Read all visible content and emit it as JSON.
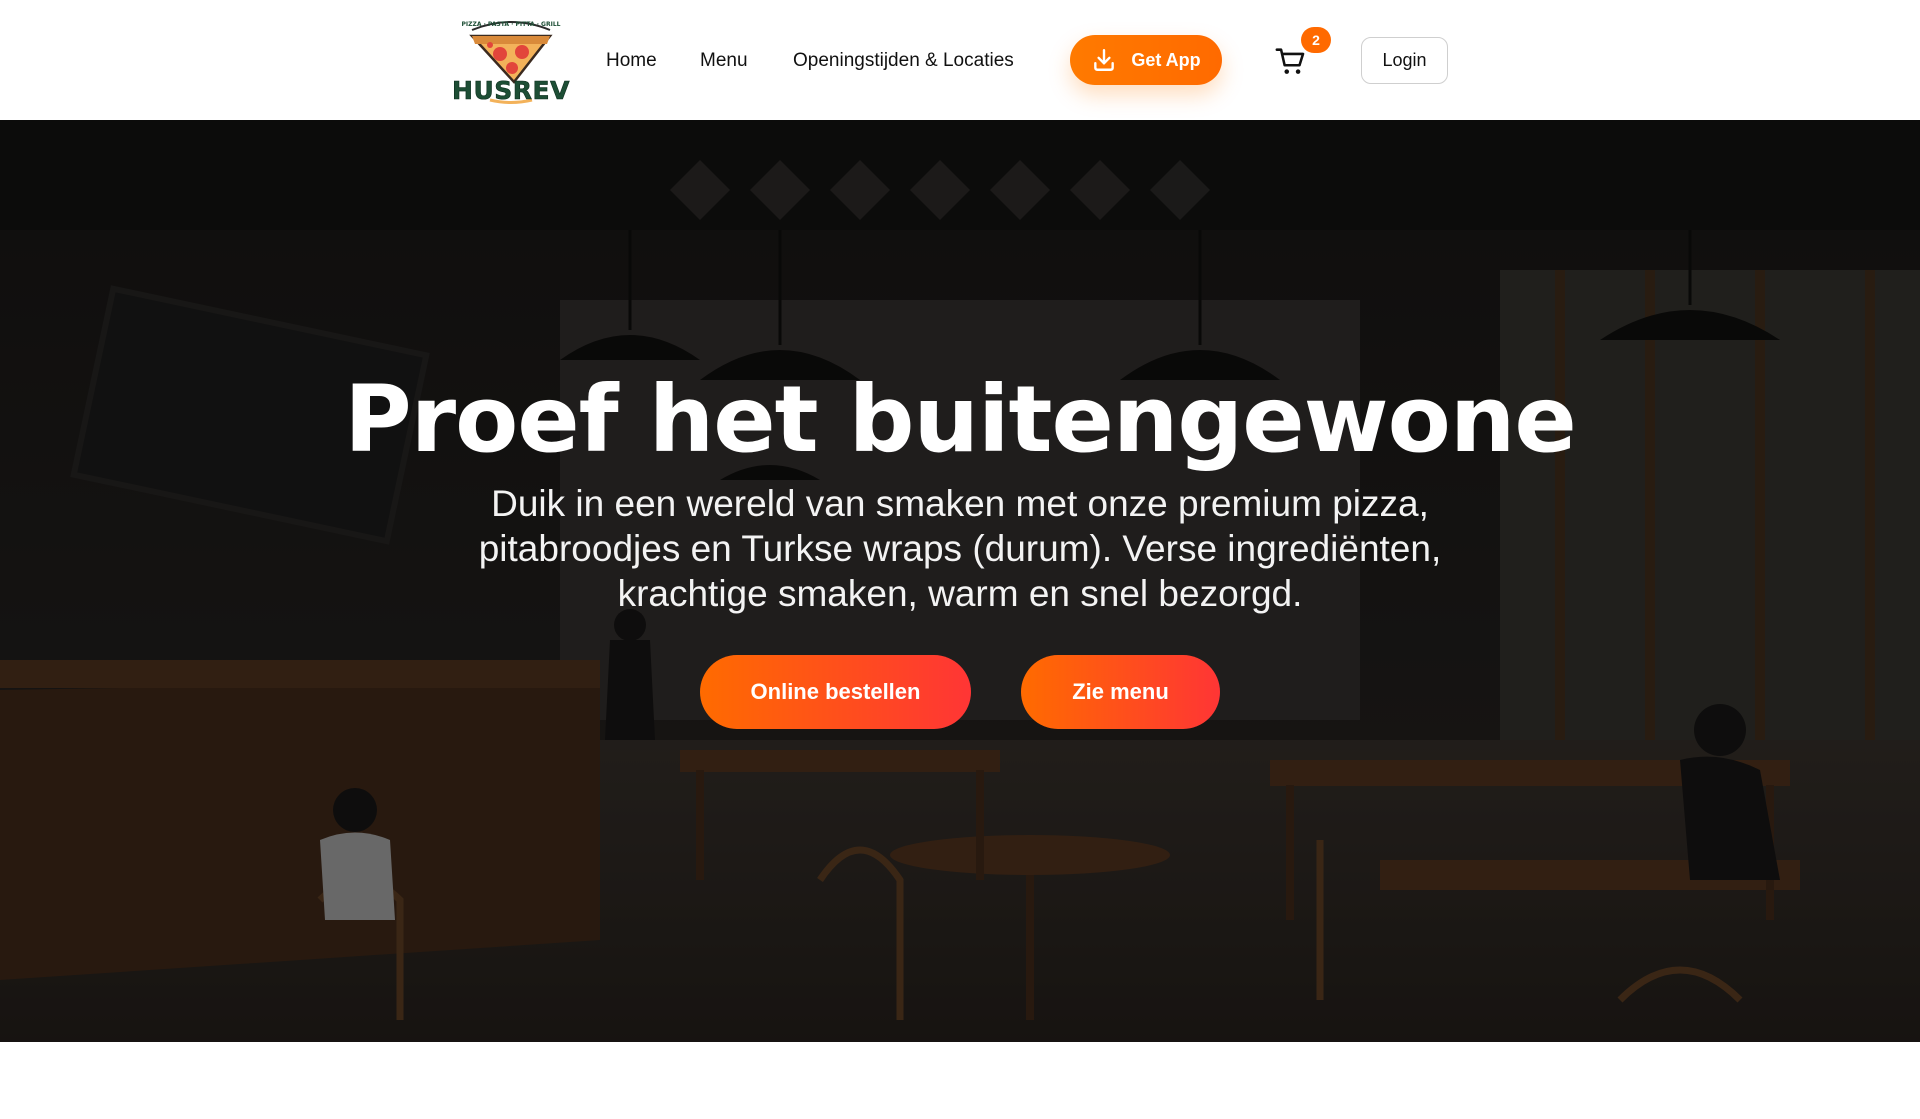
{
  "header": {
    "logo": {
      "brand": "HUSREV",
      "tagline": "PIZZA · PASTA · PITTA · GRILL"
    },
    "nav": [
      {
        "label": "Home"
      },
      {
        "label": "Menu"
      },
      {
        "label": "Openingstijden & Locaties"
      }
    ],
    "get_app": {
      "label": "Get App",
      "icon": "download-icon"
    },
    "cart": {
      "icon": "cart-icon",
      "count": "2"
    },
    "login": {
      "label": "Login"
    }
  },
  "hero": {
    "title": "Proef het buitengewone",
    "subtitle": "Duik in een wereld van smaken met onze premium pizza, pitabroodjes en Turkse wraps (durum). Verse ingrediënten, krachtige smaken, warm en snel bezorgd.",
    "buttons": [
      {
        "label": "Online bestellen"
      },
      {
        "label": "Zie menu"
      }
    ]
  },
  "colors": {
    "accent": "#ff7a00",
    "gradient_end": "#ff3535",
    "logo_green": "#1d4e35"
  }
}
